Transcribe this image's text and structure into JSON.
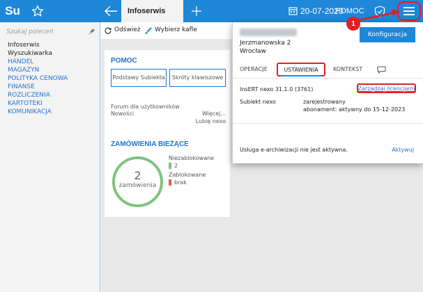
{
  "app": {
    "logo": "Su",
    "active_tab": "Infoserwis"
  },
  "topbar": {
    "date": "20-07-2020",
    "help": "POMOC"
  },
  "sidebar": {
    "search_placeholder": "Szukaj poleceń",
    "items": [
      {
        "label": "Infoserwis",
        "style": "dark"
      },
      {
        "label": "Wyszukiwarka",
        "style": "dark"
      },
      {
        "label": "HANDEL",
        "style": "blue"
      },
      {
        "label": "MAGAZYN",
        "style": "blue"
      },
      {
        "label": "POLITYKA CENOWA",
        "style": "blue"
      },
      {
        "label": "FINANSE",
        "style": "blue"
      },
      {
        "label": "ROZLICZENIA",
        "style": "blue"
      },
      {
        "label": "KARTOTEKI",
        "style": "blue"
      },
      {
        "label": "KOMUNIKACJA",
        "style": "blue"
      }
    ]
  },
  "toolbar": {
    "refresh": "Odśwież",
    "choose_tiles": "Wybierz kafle"
  },
  "help_card": {
    "title": "POMOC",
    "btn_basics": "Podstawy Subiekta",
    "btn_shortcuts": "Skróty klawiszowe",
    "forum": "Forum dla użytkowników",
    "news": "Nowości",
    "more": "Więcej...",
    "like": "Lubię nexo"
  },
  "orders_card": {
    "title": "ZAMÓWIENIA BIEŻĄCE",
    "count": "2",
    "count_label": "zamówienia",
    "unlocked_label": "Niezablokowane",
    "unlocked_value": "2",
    "blocked_label": "Zablokowane",
    "blocked_value": "brak"
  },
  "popup": {
    "address_line1": "Jerzmanowska 2",
    "address_line2": "Wrocław",
    "config_button": "Konfiguracja",
    "tabs": [
      "OPERACJE",
      "USTAWIENIA",
      "KONTEKST"
    ],
    "version": "InsERT nexo 31.1.0 (3761)",
    "manage_licenses": "Zarządzaj licencjami",
    "subject_label": "Subiekt nexo",
    "subject_status": "zarejestrowany",
    "subscription": "abonament: aktywny do 15-12-2023",
    "earchive_msg": "Usługa e-archiwizacji nie jest aktywna.",
    "activate": "Aktywuj"
  },
  "callout": {
    "number": "1"
  },
  "colors": {
    "accent": "#1e87d8",
    "highlight": "#e02020",
    "ring": "#7dc47d"
  }
}
